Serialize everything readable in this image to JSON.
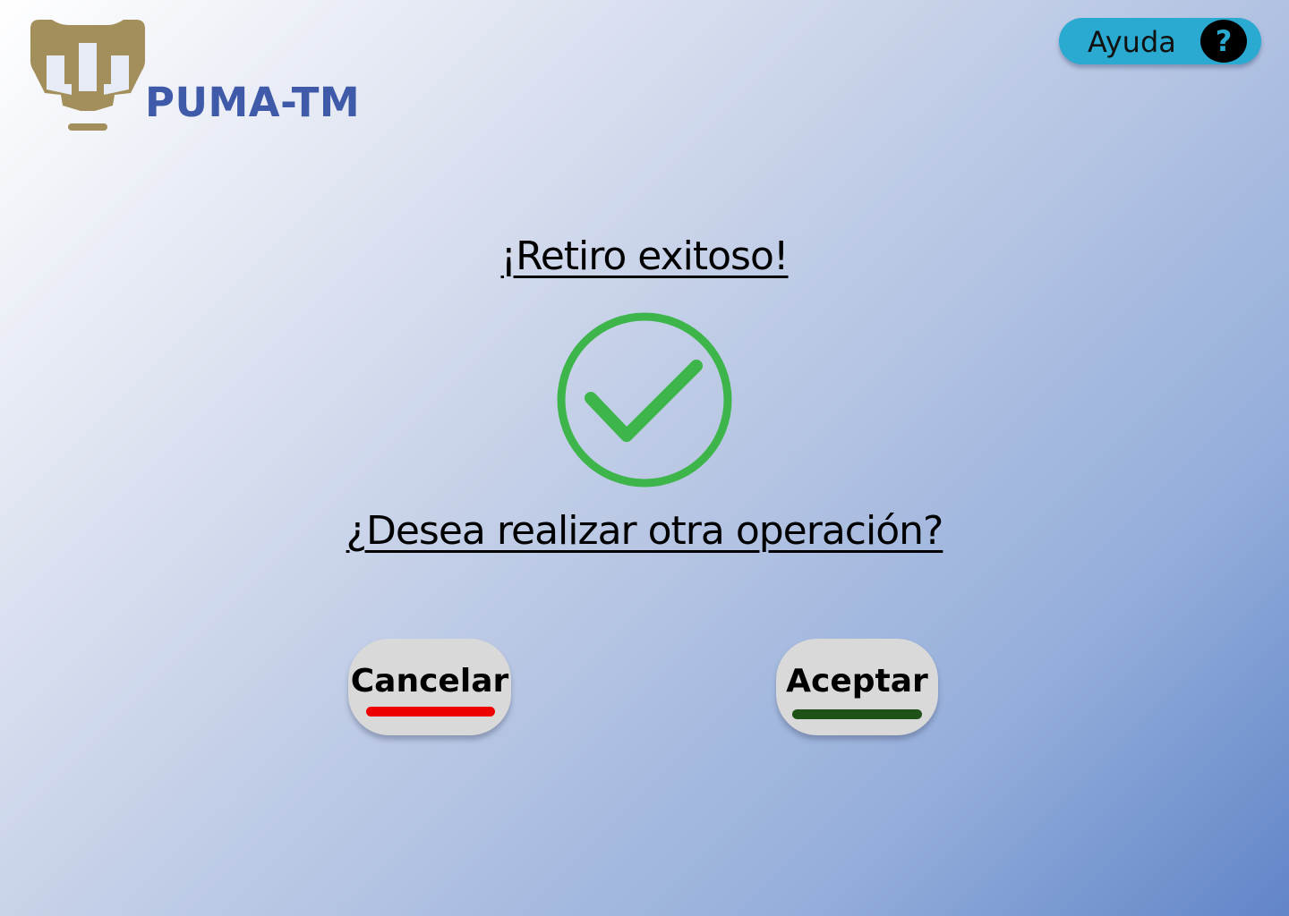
{
  "app": {
    "brand_name": "PUMA-TM",
    "colors": {
      "brand_text": "#3f5aa8",
      "logo_gold": "#a38f5c"
    }
  },
  "help": {
    "label": "Ayuda",
    "icon_glyph": "?",
    "icon_name": "question-icon",
    "color": "#2aa9d1"
  },
  "main": {
    "title": "¡Retiro exitoso!",
    "status_icon": "check-circle-icon",
    "status_color": "#3db54a",
    "question": "¿Desea realizar otra operación?"
  },
  "actions": {
    "cancel": {
      "label": "Cancelar",
      "accent_color": "#ee0000"
    },
    "accept": {
      "label": "Aceptar",
      "accent_color": "#1e5216"
    }
  }
}
